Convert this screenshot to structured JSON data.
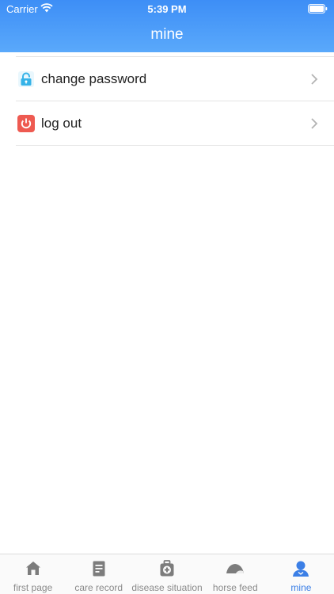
{
  "status_bar": {
    "carrier": "Carrier",
    "time": "5:39 PM"
  },
  "nav": {
    "title": "mine"
  },
  "menu": [
    {
      "label": "change password",
      "icon": "lock-icon",
      "color": "#36b3e8"
    },
    {
      "label": "log out",
      "icon": "power-icon",
      "color": "#ee5a51"
    }
  ],
  "tabs": [
    {
      "label": "first page",
      "icon": "home-icon",
      "active": false
    },
    {
      "label": "care record",
      "icon": "document-icon",
      "active": false
    },
    {
      "label": "disease situation",
      "icon": "medical-kit-icon",
      "active": false
    },
    {
      "label": "horse feed",
      "icon": "feed-icon",
      "active": false
    },
    {
      "label": "mine",
      "icon": "person-icon",
      "active": true
    }
  ],
  "colors": {
    "accent": "#3b7fe6",
    "header_top": "#3d8ef6",
    "header_bottom": "#5aa9fb"
  }
}
